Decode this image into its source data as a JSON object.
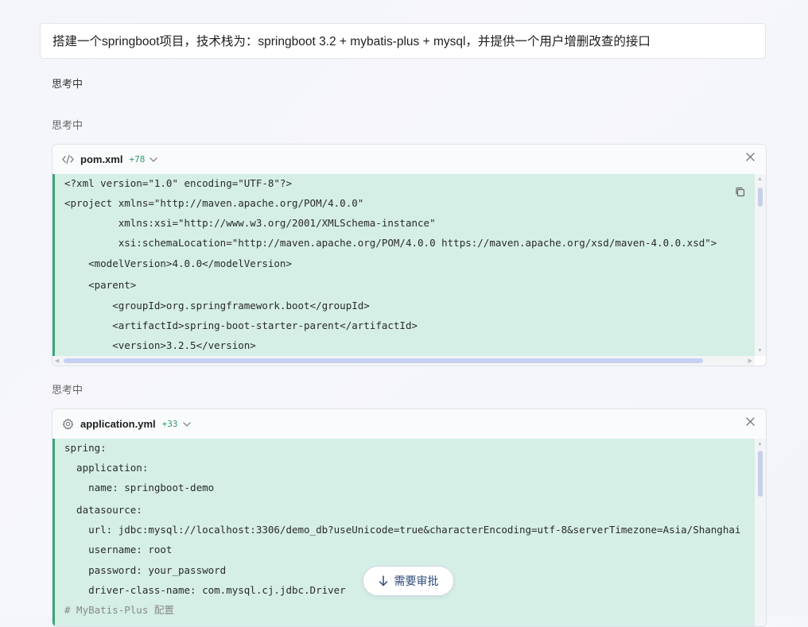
{
  "prompt": {
    "text": "搭建一个springboot项目，技术栈为：springboot 3.2 + mybatis-plus + mysql，并提供一个用户增删改查的接口"
  },
  "thinking": [
    "思考中",
    "思考中",
    "思考中"
  ],
  "files": [
    {
      "name": "pom.xml",
      "diff": "+78",
      "icon": "code-icon",
      "lines": [
        "<?xml version=\"1.0\" encoding=\"UTF-8\"?>",
        "<project xmlns=\"http://maven.apache.org/POM/4.0.0\"",
        "         xmlns:xsi=\"http://www.w3.org/2001/XMLSchema-instance\"",
        "         xsi:schemaLocation=\"http://maven.apache.org/POM/4.0.0 https://maven.apache.org/xsd/maven-4.0.0.xsd\">",
        "    <modelVersion>4.0.0</modelVersion>",
        "    <parent>",
        "        <groupId>org.springframework.boot</groupId>",
        "        <artifactId>spring-boot-starter-parent</artifactId>",
        "        <version>3.2.5</version>"
      ]
    },
    {
      "name": "application.yml",
      "diff": "+33",
      "icon": "gear-icon",
      "lines": [
        "spring:",
        "  application:",
        "    name: springboot-demo",
        "  datasource:",
        "    url: jdbc:mysql://localhost:3306/demo_db?useUnicode=true&characterEncoding=utf-8&serverTimezone=Asia/Shanghai",
        "    username: root",
        "    password: your_password",
        "    driver-class-name: com.mysql.cj.jdbc.Driver",
        "# MyBatis-Plus 配置"
      ]
    }
  ],
  "approve": {
    "label": "需要审批"
  },
  "colors": {
    "diff_added_bg": "#d5efe6",
    "diff_added_bar": "#3aa77a",
    "diff_count": "#2f9e6e",
    "scroll_thumb": "#c5d0f2"
  }
}
